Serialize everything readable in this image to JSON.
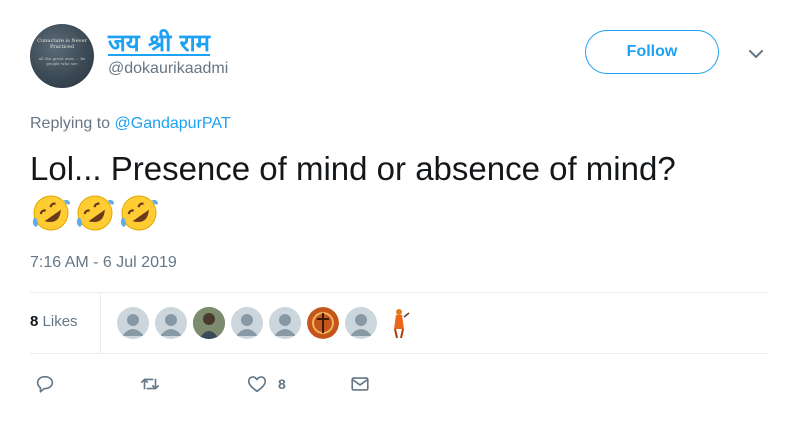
{
  "author": {
    "display_name": "जय श्री राम",
    "handle": "@dokaurikaadmi",
    "avatar_text_top": "Cunucture is Never Practiced",
    "avatar_text_bottom": "all the great ones ... be people who see"
  },
  "follow_label": "Follow",
  "reply": {
    "prefix": "Replying to ",
    "mention": "@GandapurPAT"
  },
  "tweet": {
    "text": "Lol... Presence of mind or absence of mind?",
    "emoji": [
      "rolling-on-floor-laughing",
      "rolling-on-floor-laughing",
      "rolling-on-floor-laughing"
    ],
    "timestamp": "7:16 AM - 6 Jul 2019"
  },
  "likes": {
    "count": "8",
    "label": "Likes",
    "likers": [
      "default",
      "default",
      "photo-person",
      "default",
      "default",
      "photo-orange",
      "default",
      "figure-saffron"
    ]
  },
  "actions": {
    "like_count": "8"
  },
  "colors": {
    "accent": "#1da1f2",
    "muted": "#657786",
    "text": "#14171a",
    "divider": "#e6ecf0"
  }
}
